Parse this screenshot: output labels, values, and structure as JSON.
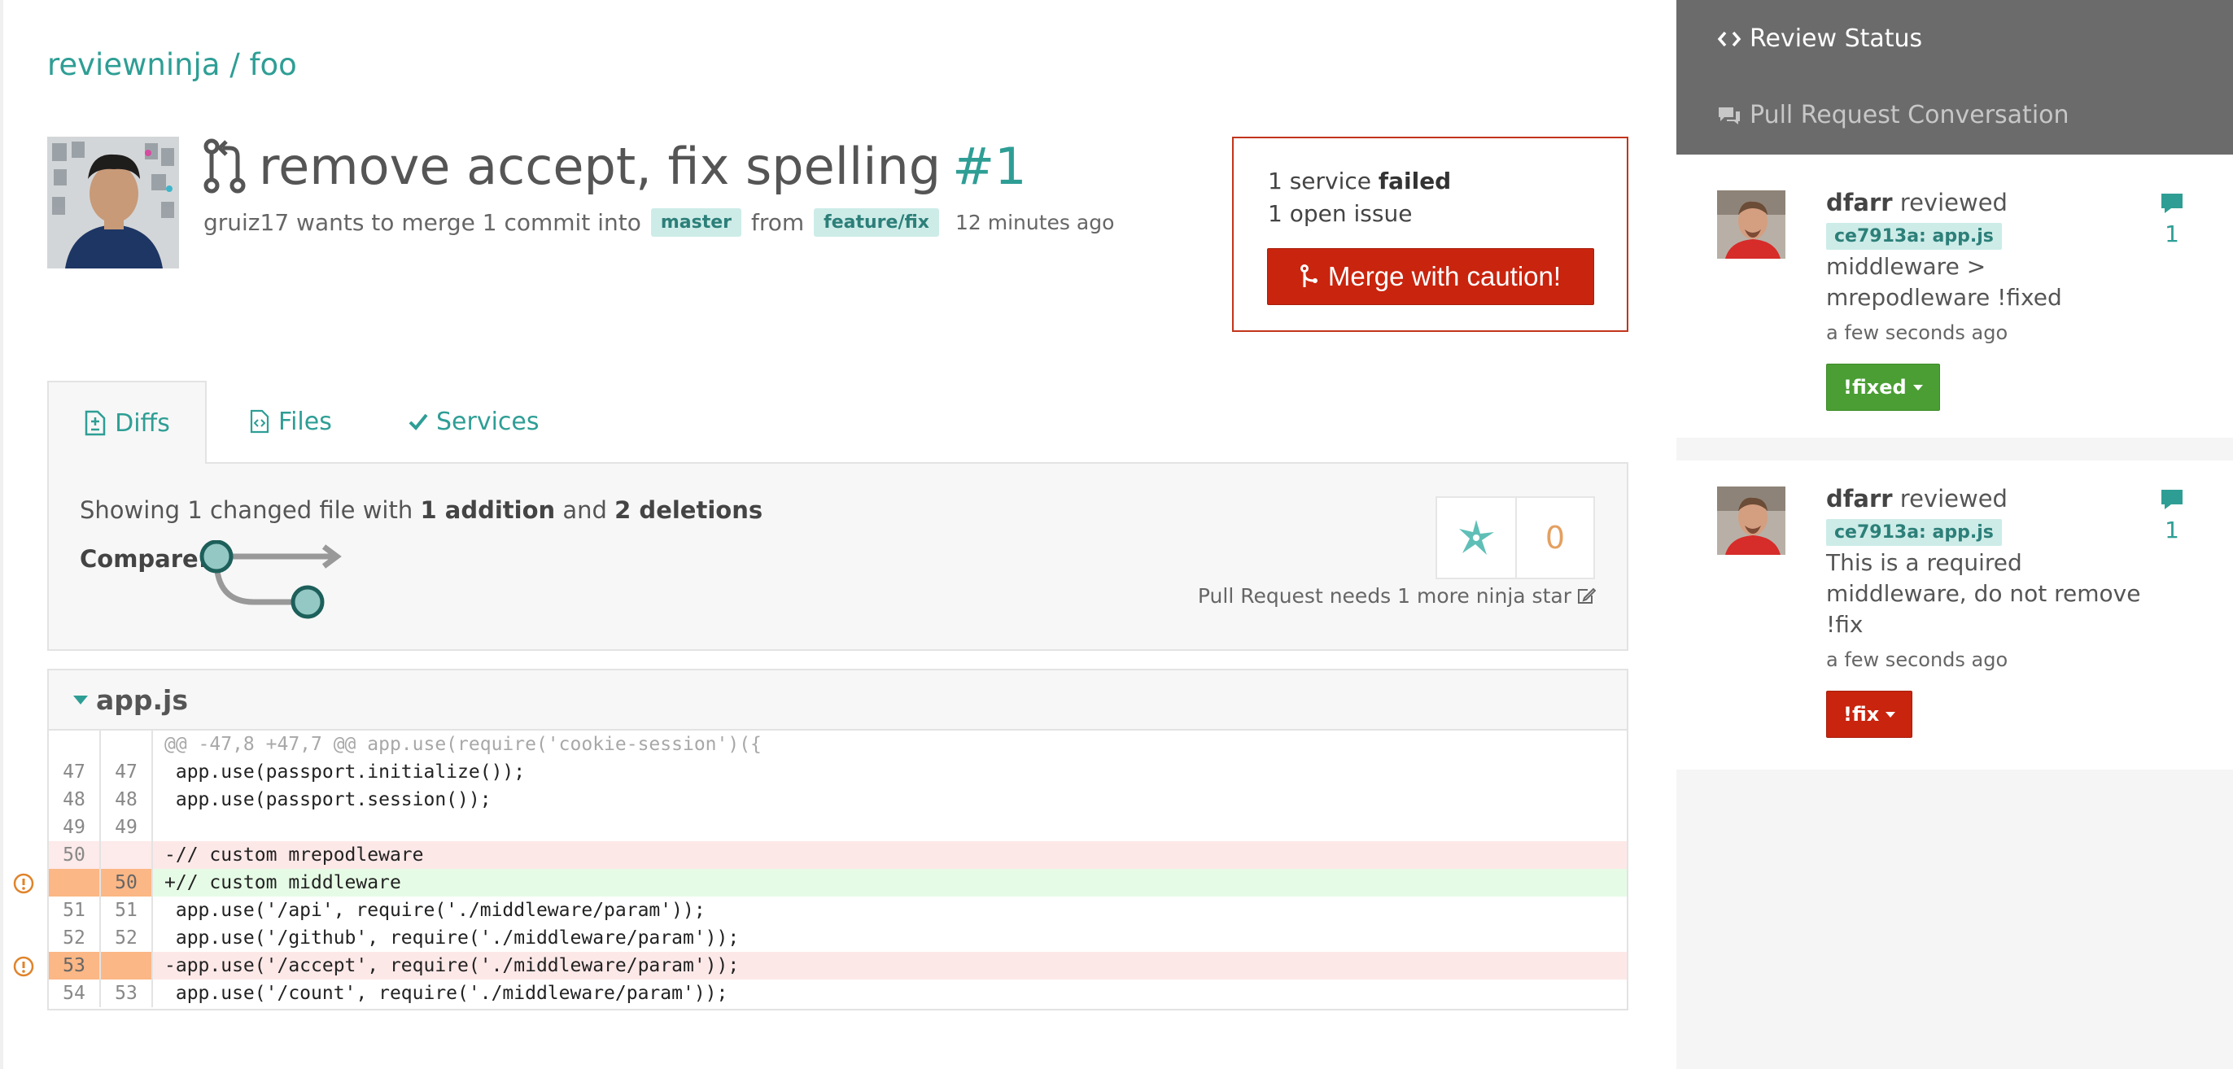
{
  "repo": {
    "breadcrumb": "reviewninja / foo"
  },
  "pull_request": {
    "title": "remove accept, fix spelling",
    "number": "#1",
    "author_text": "gruiz17 wants to merge 1 commit into",
    "base_branch": "master",
    "from_text": "from",
    "head_branch": "feature/fix",
    "time_ago": "12 minutes ago"
  },
  "status": {
    "service_prefix": "1 service ",
    "service_state": "failed",
    "open_issues": "1 open issue",
    "merge_button": "Merge with caution!",
    "accent_color": "#c9240e"
  },
  "tabs": [
    {
      "label": "Diffs",
      "icon": "file-diff-icon",
      "active": true
    },
    {
      "label": "Files",
      "icon": "file-code-icon",
      "active": false
    },
    {
      "label": "Services",
      "icon": "check-icon",
      "active": false
    }
  ],
  "summary": {
    "showing_prefix": "Showing 1 changed file with ",
    "additions": "1 addition",
    "and_text": " and ",
    "deletions": "2 deletions",
    "compare_label": "Compare:",
    "star_count": "0",
    "needs_star": "Pull Request needs 1 more ninja star"
  },
  "file": {
    "name": "app.js",
    "hunk_header": "@@ -47,8 +47,7 @@ app.use(require('cookie-session')({",
    "lines": [
      {
        "old": "47",
        "new": "47",
        "code": " app.use(passport.initialize());",
        "type": "context",
        "issue": false
      },
      {
        "old": "48",
        "new": "48",
        "code": " app.use(passport.session());",
        "type": "context",
        "issue": false
      },
      {
        "old": "49",
        "new": "49",
        "code": "",
        "type": "context",
        "issue": false
      },
      {
        "old": "50",
        "new": "",
        "code": "-// custom mrepodleware",
        "type": "del",
        "issue": false
      },
      {
        "old": "",
        "new": "50",
        "code": "+// custom middleware",
        "type": "add",
        "issue": true
      },
      {
        "old": "51",
        "new": "51",
        "code": " app.use('/api', require('./middleware/param'));",
        "type": "context",
        "issue": false
      },
      {
        "old": "52",
        "new": "52",
        "code": " app.use('/github', require('./middleware/param'));",
        "type": "context",
        "issue": false
      },
      {
        "old": "53",
        "new": "",
        "code": "-app.use('/accept', require('./middleware/param'));",
        "type": "del",
        "issue": true
      },
      {
        "old": "54",
        "new": "53",
        "code": " app.use('/count', require('./middleware/param'));",
        "type": "context",
        "issue": false
      }
    ]
  },
  "sidebar": {
    "review_status": "Review Status",
    "conversation": "Pull Request Conversation",
    "comments": [
      {
        "user": "dfarr",
        "action": " reviewed",
        "commit": "ce7913a: app.js",
        "text_lines": [
          "middleware >",
          "mrepodleware !fixed"
        ],
        "when": "a few seconds ago",
        "button": "!fixed",
        "button_color": "#4a9e33",
        "count": "1"
      },
      {
        "user": "dfarr",
        "action": " reviewed",
        "commit": "ce7913a: app.js",
        "text_lines": [
          "This is a required",
          "middleware, do not remove",
          "!fix"
        ],
        "when": "a few seconds ago",
        "button": "!fix",
        "button_color": "#c9240e",
        "count": "1"
      }
    ]
  }
}
